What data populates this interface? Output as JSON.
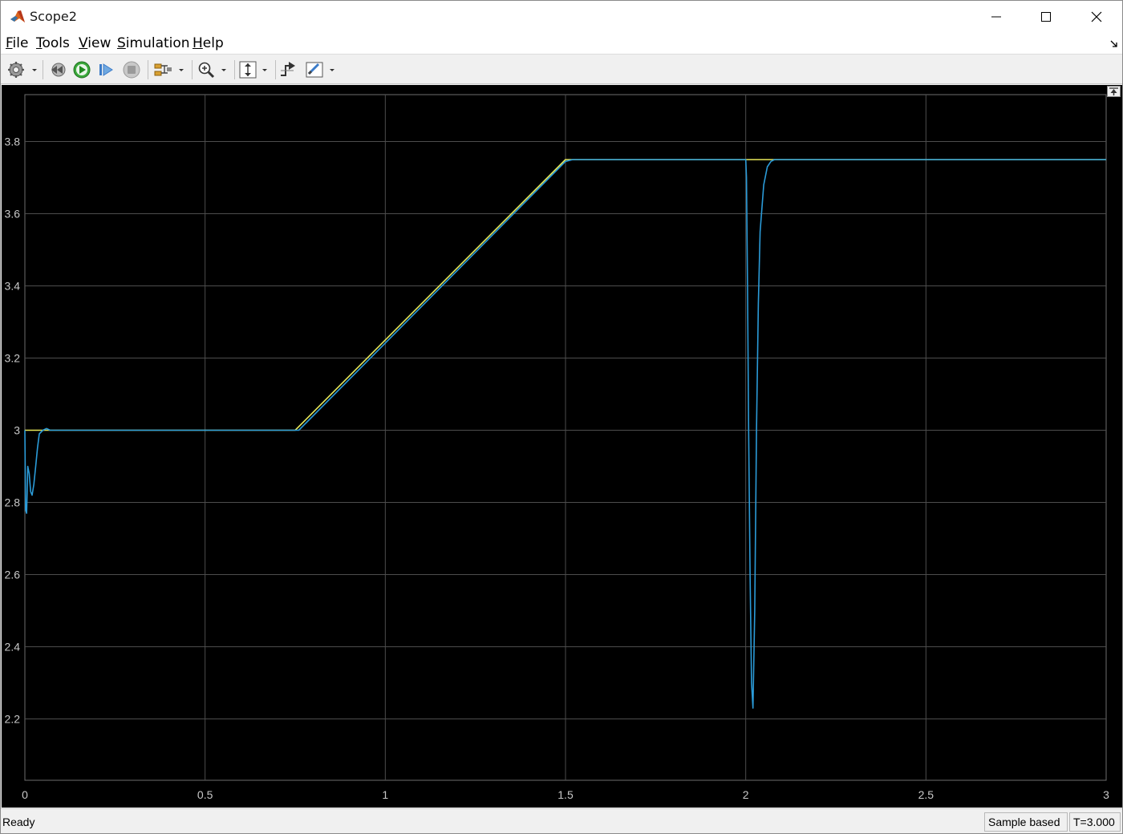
{
  "window": {
    "title": "Scope2",
    "controls": [
      "minimize",
      "maximize",
      "close"
    ]
  },
  "menu": {
    "file": "File",
    "tools": "Tools",
    "view": "View",
    "simulation": "Simulation",
    "help": "Help"
  },
  "toolbar": {
    "icons": [
      "gear-icon",
      "step-back-icon",
      "run-icon",
      "step-forward-icon",
      "stop-icon",
      "signal-select-icon",
      "zoom-icon",
      "autoscale-icon",
      "trigger-icon",
      "cursor-measure-icon"
    ]
  },
  "status": {
    "ready": "Ready",
    "mode": "Sample based",
    "time": "T=3.000"
  },
  "colors": {
    "background": "#000000",
    "grid": "#4d4d4d",
    "series_blue": "#2b9bd8",
    "series_yellow": "#e8e85a",
    "tick_label": "#c8c8c8"
  },
  "chart_data": {
    "type": "line",
    "title": "",
    "xlabel": "",
    "ylabel": "",
    "xlim": [
      0,
      3
    ],
    "ylim": [
      2.03,
      3.93
    ],
    "x_ticks": [
      "0",
      "0.5",
      "1",
      "1.5",
      "2",
      "2.5",
      "3"
    ],
    "y_ticks": [
      "2.2",
      "2.4",
      "2.6",
      "2.8",
      "3",
      "3.2",
      "3.4",
      "3.6",
      "3.8"
    ],
    "grid": true,
    "series": [
      {
        "color": "#e8e85a",
        "x": [
          0,
          0.75,
          1.5,
          3
        ],
        "y": [
          3.0,
          3.0,
          3.75,
          3.75
        ]
      },
      {
        "color": "#2b9bd8",
        "x": [
          0,
          0.002,
          0.005,
          0.008,
          0.012,
          0.016,
          0.02,
          0.025,
          0.03,
          0.035,
          0.04,
          0.05,
          0.06,
          0.07,
          0.75,
          0.76,
          1.5,
          1.52,
          2.0,
          2.002,
          2.005,
          2.008,
          2.012,
          2.016,
          2.02,
          2.025,
          2.03,
          2.035,
          2.04,
          2.05,
          2.06,
          2.07,
          2.08,
          3.0
        ],
        "y": [
          3.0,
          2.78,
          2.77,
          2.9,
          2.88,
          2.83,
          2.82,
          2.85,
          2.9,
          2.95,
          2.99,
          3.0,
          3.005,
          3.0,
          3.0,
          3.0,
          3.745,
          3.75,
          3.75,
          3.7,
          3.4,
          3.0,
          2.6,
          2.3,
          2.23,
          2.5,
          3.0,
          3.35,
          3.55,
          3.68,
          3.73,
          3.745,
          3.75,
          3.75
        ]
      }
    ]
  }
}
